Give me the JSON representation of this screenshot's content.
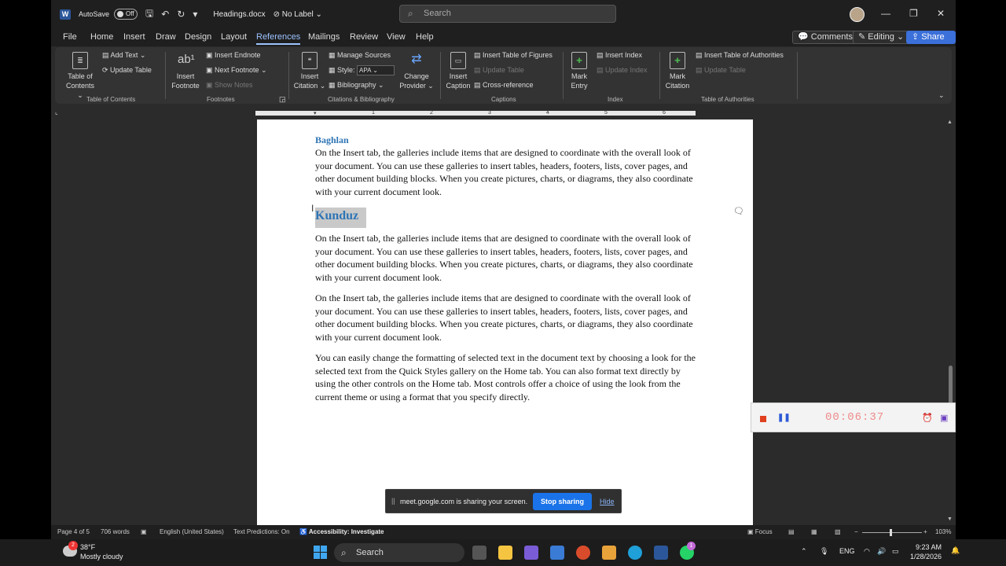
{
  "titlebar": {
    "autosave_label": "AutoSave",
    "autosave_state": "Off",
    "filename": "Headings.docx",
    "sensitivity": "No Label",
    "search_placeholder": "Search"
  },
  "tabs": [
    "File",
    "Home",
    "Insert",
    "Draw",
    "Design",
    "Layout",
    "References",
    "Mailings",
    "Review",
    "View",
    "Help"
  ],
  "active_tab": "References",
  "tab_buttons": {
    "comments": "Comments",
    "editing": "Editing",
    "share": "Share"
  },
  "ribbon": {
    "toc": {
      "table_of_contents": "Table of Contents",
      "add_text": "Add Text",
      "update_table": "Update Table",
      "group": "Table of Contents"
    },
    "footnotes": {
      "insert_footnote": "Insert Footnote",
      "insert_endnote": "Insert Endnote",
      "next_footnote": "Next Footnote",
      "show_notes": "Show Notes",
      "group": "Footnotes"
    },
    "citations": {
      "insert_citation": "Insert Citation",
      "manage_sources": "Manage Sources",
      "style_label": "Style:",
      "style_value": "APA",
      "bibliography": "Bibliography",
      "change_provider": "Change Provider",
      "group": "Citations & Bibliography"
    },
    "captions": {
      "insert_caption": "Insert Caption",
      "insert_table_of_figures": "Insert Table of Figures",
      "update_table": "Update Table",
      "cross_reference": "Cross-reference",
      "group": "Captions"
    },
    "index": {
      "mark_entry": "Mark Entry",
      "insert_index": "Insert Index",
      "update_index": "Update Index",
      "group": "Index"
    },
    "authorities": {
      "mark_citation": "Mark Citation",
      "insert_table_of_authorities": "Insert Table of Authorities",
      "update_table": "Update Table",
      "group": "Table of Authorities"
    }
  },
  "ruler_numbers": [
    "1",
    "2",
    "3",
    "4",
    "5",
    "6"
  ],
  "document": {
    "heading2": "Baghlan",
    "heading1": "Kunduz",
    "paragraphs": [
      "On the Insert tab, the galleries include items that are designed to coordinate with the overall look of your document. You can use these galleries to insert tables, headers, footers, lists, cover pages, and other document building blocks. When you create pictures, charts, or diagrams, they also coordinate with your current document look.",
      "On the Insert tab, the galleries include items that are designed to coordinate with the overall look of your document. You can use these galleries to insert tables, headers, footers, lists, cover pages, and other document building blocks. When you create pictures, charts, or diagrams, they also coordinate with your current document look.",
      "On the Insert tab, the galleries include items that are designed to coordinate with the overall look of your document. You can use these galleries to insert tables, headers, footers, lists, cover pages, and other document building blocks. When you create pictures, charts, or diagrams, they also coordinate with your current document look.",
      "You can easily change the formatting of selected text in the document text by choosing a look for the selected text from the Quick Styles gallery on the Home tab. You can also format text directly by using the other controls on the Home tab. Most controls offer a choice of using the look from the current theme or using a format that you specify directly."
    ]
  },
  "statusbar": {
    "page": "Page 4 of 5",
    "words": "706 words",
    "language": "English (United States)",
    "predictions": "Text Predictions: On",
    "accessibility": "Accessibility: Investigate",
    "focus": "Focus",
    "zoom": "103%"
  },
  "recorder": {
    "timer": "00:06:37"
  },
  "sharebar": {
    "text": "meet.google.com is sharing your screen.",
    "stop": "Stop sharing",
    "hide": "Hide"
  },
  "taskbar": {
    "temperature": "38°F",
    "weather": "Mostly cloudy",
    "weather_badge": "2",
    "search": "Search",
    "whatsapp_badge": "1",
    "language": "ENG",
    "time": "9:23 AM",
    "date": "1/28/2026"
  },
  "colors": {
    "accent": "#9cc3ff",
    "heading": "#2e74b5",
    "share": "#3b6fd9",
    "stop_sharing": "#1a73e8"
  }
}
